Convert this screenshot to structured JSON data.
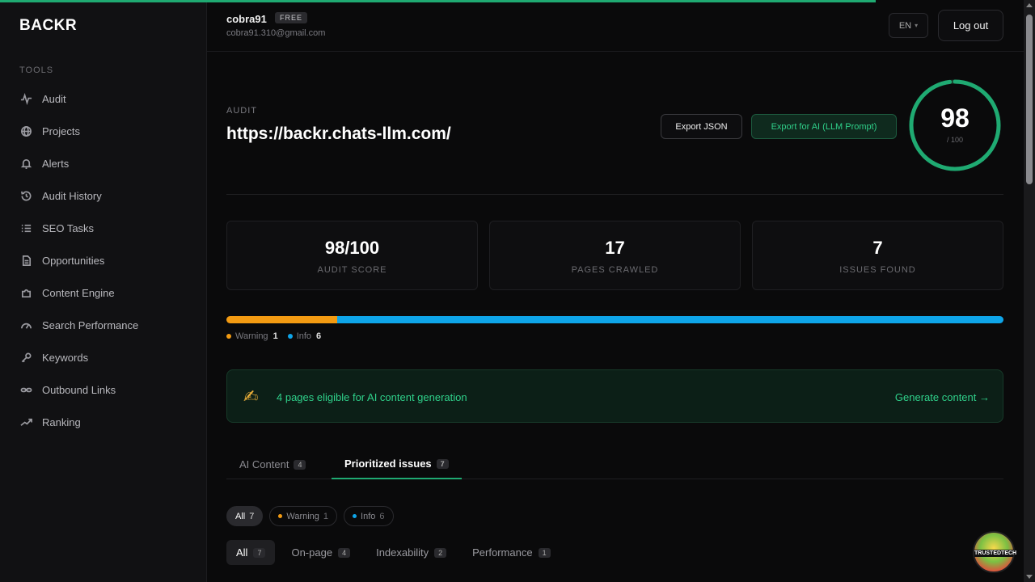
{
  "brand": "BACKR",
  "sidebar": {
    "section_label": "TOOLS",
    "items": [
      {
        "label": "Audit",
        "icon": "pulse-icon"
      },
      {
        "label": "Projects",
        "icon": "globe-icon"
      },
      {
        "label": "Alerts",
        "icon": "bell-icon"
      },
      {
        "label": "Audit History",
        "icon": "history-icon"
      },
      {
        "label": "SEO Tasks",
        "icon": "list-icon"
      },
      {
        "label": "Opportunities",
        "icon": "file-icon"
      },
      {
        "label": "Content Engine",
        "icon": "puzzle-icon"
      },
      {
        "label": "Search Performance",
        "icon": "gauge-icon"
      },
      {
        "label": "Keywords",
        "icon": "key-icon"
      },
      {
        "label": "Outbound Links",
        "icon": "link-icon"
      },
      {
        "label": "Ranking",
        "icon": "trend-icon"
      }
    ]
  },
  "header": {
    "username": "cobra91",
    "badge": "FREE",
    "email": "cobra91.310@gmail.com",
    "lang": "EN",
    "logout": "Log out"
  },
  "audit": {
    "label": "AUDIT",
    "url": "https://backr.chats-llm.com/",
    "export_json": "Export JSON",
    "export_ai": "Export for AI (LLM Prompt)",
    "score": "98",
    "score_max": "/ 100",
    "score_fraction": 0.98
  },
  "stats": [
    {
      "value": "98/100",
      "label": "AUDIT SCORE"
    },
    {
      "value": "17",
      "label": "PAGES CRAWLED"
    },
    {
      "value": "7",
      "label": "ISSUES FOUND"
    }
  ],
  "distribution": {
    "warning_label": "Warning",
    "warning_count": "1",
    "info_label": "Info",
    "info_count": "6",
    "warning_fraction": 0.142857,
    "info_fraction": 0.857143
  },
  "ai_banner": {
    "text": "4 pages eligible for AI content generation",
    "cta": "Generate content →"
  },
  "tabs": [
    {
      "label": "AI Content",
      "count": "4"
    },
    {
      "label": "Prioritized issues",
      "count": "7"
    }
  ],
  "severity_filters": [
    {
      "label": "All",
      "count": "7"
    },
    {
      "label": "Warning",
      "count": "1"
    },
    {
      "label": "Info",
      "count": "6"
    }
  ],
  "category_filters": [
    {
      "label": "All",
      "count": "7"
    },
    {
      "label": "On-page",
      "count": "4"
    },
    {
      "label": "Indexability",
      "count": "2"
    },
    {
      "label": "Performance",
      "count": "1"
    }
  ],
  "floating_badge": "TRUSTEDTECH",
  "colors": {
    "accent": "#1faa72",
    "warning": "#f39b12",
    "info": "#0ea5e9"
  }
}
